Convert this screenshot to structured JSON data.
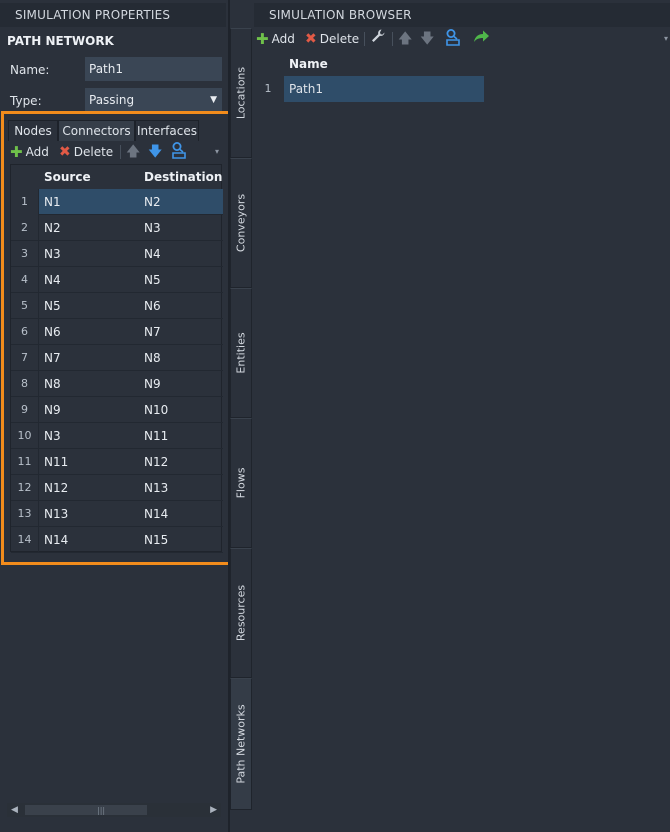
{
  "left_panel": {
    "header": "SIMULATION PROPERTIES",
    "section_title": "PATH NETWORK",
    "name_label": "Name:",
    "name_value": "Path1",
    "type_label": "Type:",
    "type_value": "Passing",
    "tabs": [
      {
        "label": "Nodes",
        "active": false
      },
      {
        "label": "Connectors",
        "active": true
      },
      {
        "label": "Interfaces",
        "active": false
      }
    ],
    "toolbar": {
      "add_label": "Add",
      "delete_label": "Delete"
    },
    "table": {
      "columns": [
        "Source",
        "Destination"
      ],
      "rows": [
        {
          "n": "1",
          "source": "N1",
          "destination": "N2"
        },
        {
          "n": "2",
          "source": "N2",
          "destination": "N3"
        },
        {
          "n": "3",
          "source": "N3",
          "destination": "N4"
        },
        {
          "n": "4",
          "source": "N4",
          "destination": "N5"
        },
        {
          "n": "5",
          "source": "N5",
          "destination": "N6"
        },
        {
          "n": "6",
          "source": "N6",
          "destination": "N7"
        },
        {
          "n": "7",
          "source": "N7",
          "destination": "N8"
        },
        {
          "n": "8",
          "source": "N8",
          "destination": "N9"
        },
        {
          "n": "9",
          "source": "N9",
          "destination": "N10"
        },
        {
          "n": "10",
          "source": "N3",
          "destination": "N11"
        },
        {
          "n": "11",
          "source": "N11",
          "destination": "N12"
        },
        {
          "n": "12",
          "source": "N12",
          "destination": "N13"
        },
        {
          "n": "13",
          "source": "N13",
          "destination": "N14"
        },
        {
          "n": "14",
          "source": "N14",
          "destination": "N15"
        }
      ]
    }
  },
  "side_tabs": [
    "Locations",
    "Conveyors",
    "Entities",
    "Flows",
    "Resources",
    "Path Networks"
  ],
  "right_panel": {
    "header": "SIMULATION BROWSER",
    "toolbar": {
      "add_label": "Add",
      "delete_label": "Delete"
    },
    "table": {
      "column": "Name",
      "rows": [
        {
          "n": "1",
          "name": "Path1"
        }
      ]
    }
  },
  "colors": {
    "accent_highlight": "#f28c1c",
    "selection": "#2f4d69",
    "add_icon": "#6fc14a",
    "delete_icon": "#e25a46"
  }
}
